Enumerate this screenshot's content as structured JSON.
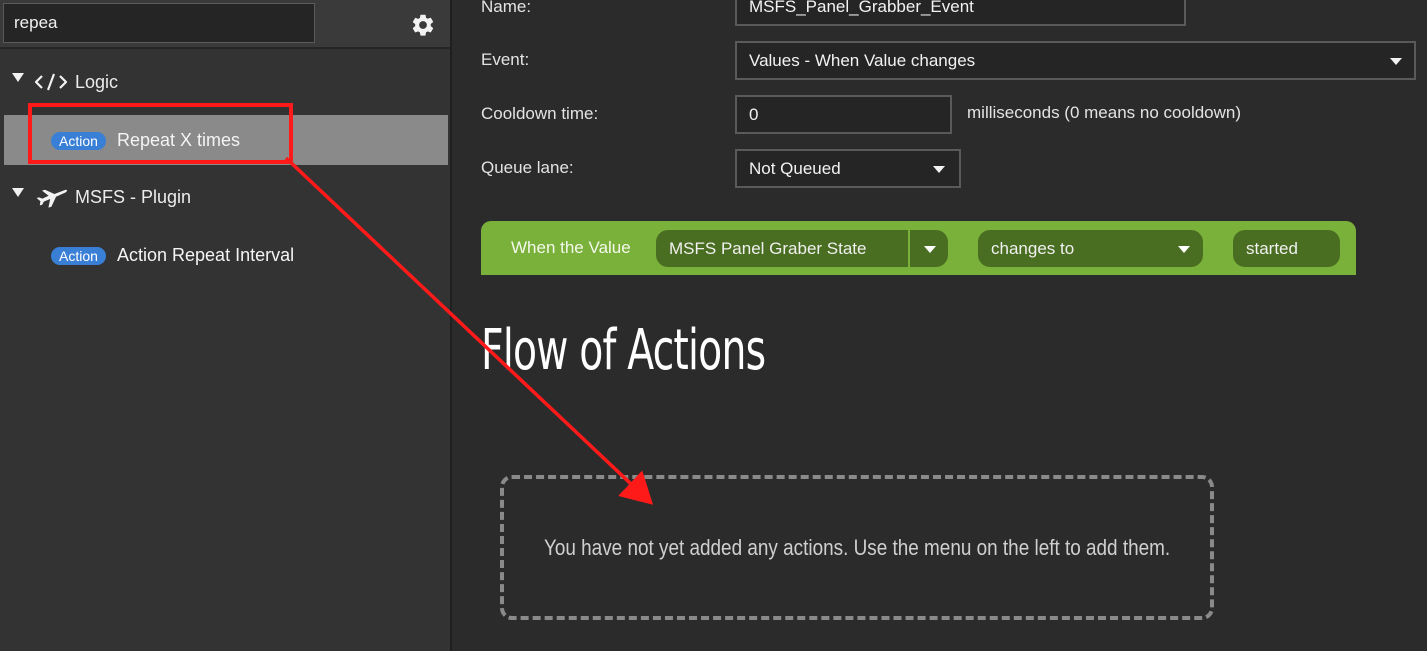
{
  "sidebar": {
    "search": {
      "value": "repea",
      "placeholder": ""
    },
    "settings_icon": "gear-icon",
    "groups": [
      {
        "label": "Logic",
        "icon": "code-icon",
        "expanded": true,
        "items": [
          {
            "badge": "Action",
            "label": "Repeat X times",
            "selected": true
          }
        ]
      },
      {
        "label": "MSFS - Plugin",
        "icon": "airplane-icon",
        "expanded": true,
        "items": [
          {
            "badge": "Action",
            "label": "Action Repeat Interval",
            "selected": false
          }
        ]
      }
    ]
  },
  "form": {
    "name_label": "Name:",
    "name_value": "MSFS_Panel_Grabber_Event",
    "event_label": "Event:",
    "event_value": "Values - When Value changes",
    "cooldown_label": "Cooldown time:",
    "cooldown_value": "0",
    "cooldown_hint": "milliseconds (0 means no cooldown)",
    "queue_label": "Queue lane:",
    "queue_value": "Not Queued"
  },
  "when_bar": {
    "label": "When the Value",
    "value_select": "MSFS Panel Graber State",
    "condition_select": "changes to",
    "target_value": "started",
    "color": "#7ab13a"
  },
  "flow": {
    "title": "Flow of Actions",
    "empty_message": "You have not yet added any actions. Use the menu on the left to add them."
  },
  "colors": {
    "accent_badge": "#3a7fd6",
    "annotation": "#ff1a1a",
    "selected_row": "#8a8a8a"
  }
}
